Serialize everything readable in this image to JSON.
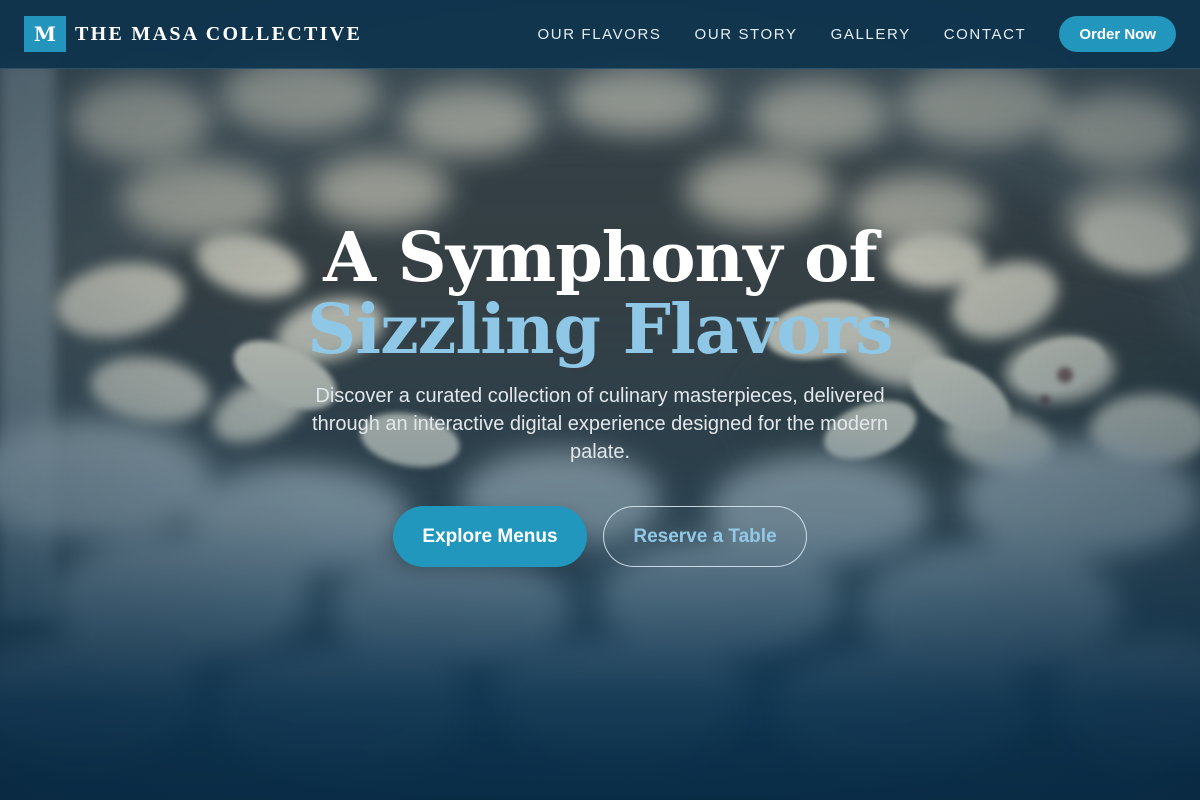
{
  "brand": {
    "mark": "M",
    "name": "THE MASA COLLECTIVE"
  },
  "nav": {
    "links": [
      "OUR FLAVORS",
      "OUR STORY",
      "GALLERY",
      "CONTACT"
    ],
    "order_button": "Order Now"
  },
  "hero": {
    "title_line1": "A Symphony of",
    "title_line2": "Sizzling Flavors",
    "description": "Discover a curated collection of culinary masterpieces, delivered through an interactive digital experience designed for the modern palate.",
    "primary_button": "Explore Menus",
    "secondary_button": "Reserve a Table"
  },
  "colors": {
    "accent": "#2296bd",
    "title_highlight": "#8fc7e6",
    "navbar_bg": "#0e344c",
    "hero_bottom": "#09304c"
  }
}
